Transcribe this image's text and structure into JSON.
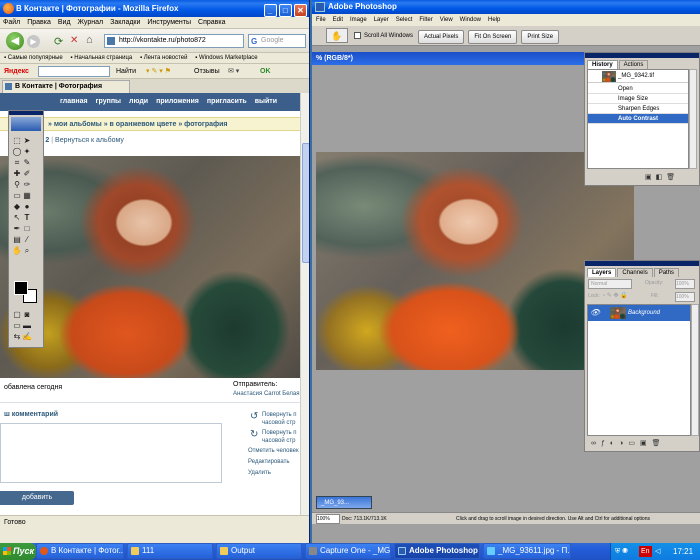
{
  "firefox": {
    "title": "В Контакте | Фотографии - Mozilla Firefox",
    "menu": [
      "Файл",
      "Правка",
      "Вид",
      "Журнал",
      "Закладки",
      "Инструменты",
      "Справка"
    ],
    "url": "http://vkontakte.ru/photo872",
    "search_placeholder": "Google",
    "bookmarks": [
      "Самые популярные",
      "Начальная страница",
      "Лента новостей",
      "Windows Marketplace"
    ],
    "yandex_bar": {
      "logo": "Яндекс",
      "find": "Найти",
      "reviews": "Отзывы",
      "ok": "OK"
    },
    "tab": "В Контакте | Фотография",
    "status": "Готово"
  },
  "vk": {
    "nav": [
      "главная",
      "группы",
      "люди",
      "приложения",
      "пригласить",
      "выйти"
    ],
    "breadcrumb": "» мои альбомы » в оранжевом цвете » фотография",
    "photo_count": "з 2",
    "back_link": "Вернуться к альбому",
    "added": "обавлена сегодня",
    "sender_label": "Отправитель:",
    "sender_name": "Анастасия Carrot Белая",
    "comment_title": "ш комментарий",
    "actions": [
      "Повернуть п часовой стр",
      "Повернуть п часовой стр",
      "Отметить человек",
      "Редактировать",
      "Удалить"
    ],
    "add_comment": "добавить комментарий"
  },
  "photoshop": {
    "title": "Adobe Photoshop",
    "menu": [
      "File",
      "Edit",
      "Image",
      "Layer",
      "Select",
      "Filter",
      "View",
      "Window",
      "Help"
    ],
    "options": {
      "scroll_all": "Scroll All Windows",
      "buttons": [
        "Actual Pixels",
        "Fit On Screen",
        "Print Size"
      ]
    },
    "doc_title": "% (RGB/8*)",
    "doc_title_right": "",
    "status_zoom": "100%",
    "status_doc": "Doc: 713.1K/713.1K",
    "status_hint": "Click and drag to scroll image in desired direction. Use Alt and Ctrl for additional options",
    "minimized": "_MG_93..."
  },
  "history": {
    "tabs": [
      "History",
      "Actions"
    ],
    "snapshot": "_MG_9342.tif",
    "rows": [
      "Open",
      "Image Size",
      "Sharpen Edges",
      "Auto Contrast"
    ],
    "active": 3
  },
  "layers": {
    "tabs": [
      "Layers",
      "Channels",
      "Paths"
    ],
    "mode": "Normal",
    "opacity_label": "Opacity:",
    "opacity": "100%",
    "lock_label": "Lock:",
    "fill_label": "Fill:",
    "fill": "100%",
    "layer_name": "Background"
  },
  "taskbar": {
    "start": "Пуск",
    "items": [
      "В Контакте | Фотог...",
      "111",
      "Output",
      "Capture One - _MG...",
      "Adobe Photoshop",
      "_MG_93611.jpg - П..."
    ],
    "active": 4,
    "lang": "En",
    "time": "17:21"
  }
}
